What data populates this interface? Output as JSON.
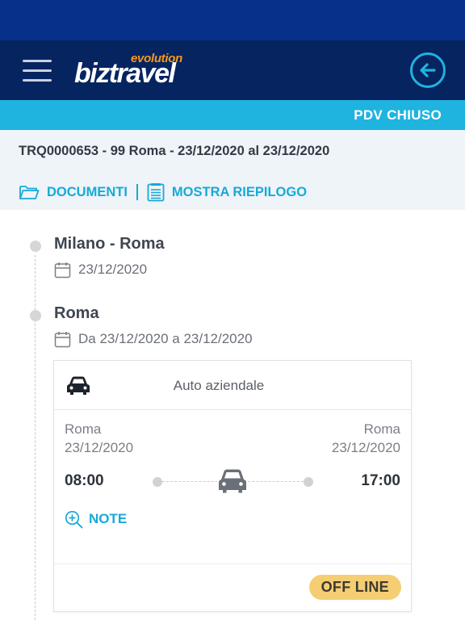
{
  "header": {
    "logo_main": "biztravel",
    "logo_sub": "evolution"
  },
  "status": {
    "pdv": "PDV CHIUSO"
  },
  "trip": {
    "title": "TRQ0000653 - 99 Roma - 23/12/2020 al 23/12/2020",
    "documents_label": "DOCUMENTI",
    "summary_label": "MOSTRA RIEPILOGO"
  },
  "stops": [
    {
      "title": "Milano - Roma",
      "date": "23/12/2020"
    },
    {
      "title": "Roma",
      "date": "Da 23/12/2020 a 23/12/2020"
    }
  ],
  "card": {
    "type": "Auto aziendale",
    "from_city": "Roma",
    "from_date": "23/12/2020",
    "to_city": "Roma",
    "to_date": "23/12/2020",
    "depart_time": "08:00",
    "arrive_time": "17:00",
    "note_label": "NOTE",
    "badge": "OFF LINE"
  },
  "colors": {
    "primary_dark": "#062460",
    "accent": "#1fb3e0",
    "link": "#17a9d8",
    "badge_bg": "#f5cd73",
    "logo_orange": "#f59a1c"
  },
  "icons": [
    "menu-icon",
    "back-arrow-icon",
    "folder-icon",
    "document-list-icon",
    "calendar-icon",
    "car-icon",
    "zoom-plus-icon"
  ]
}
